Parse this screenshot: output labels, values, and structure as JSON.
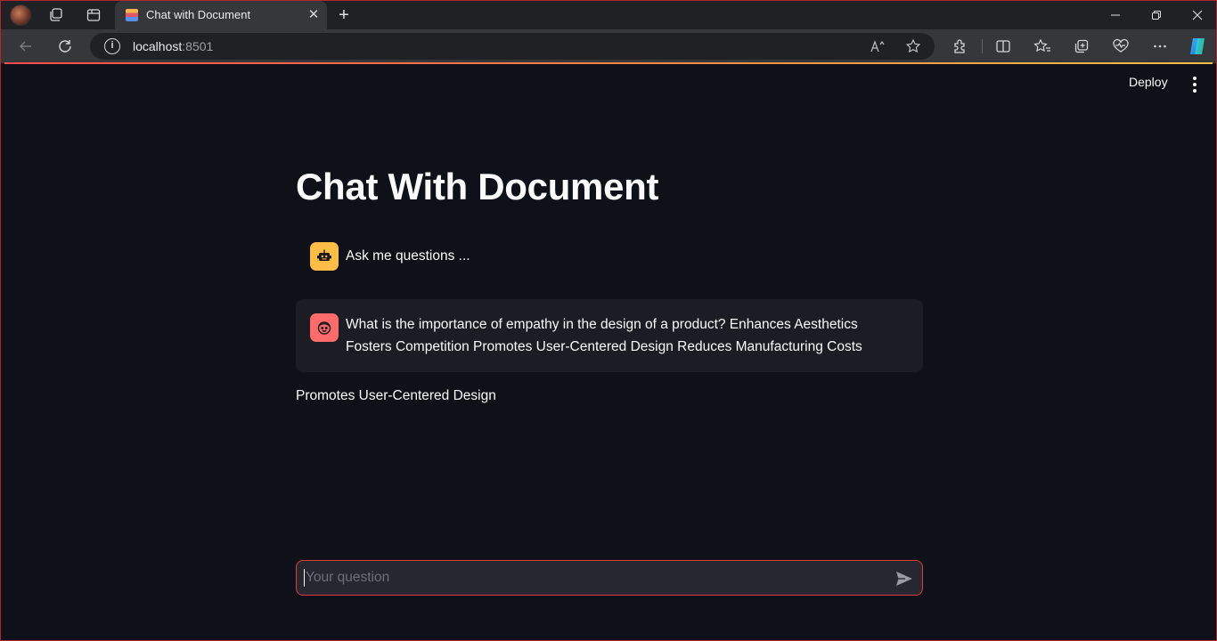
{
  "browser": {
    "tab_title": "Chat with Document",
    "url_host": "localhost",
    "url_port": ":8501"
  },
  "app": {
    "deploy_label": "Deploy",
    "title": "Chat With Document",
    "messages": [
      {
        "role": "assistant",
        "avatar_icon": "robot-icon",
        "text": "Ask me questions ..."
      },
      {
        "role": "user",
        "avatar_icon": "smiley-face-icon",
        "text": "What is the importance of empathy in the design of a product? Enhances Aesthetics Fosters Competition Promotes User-Centered Design Reduces Manufacturing Costs"
      }
    ],
    "answer": "Promotes User-Centered Design",
    "chat_input": {
      "placeholder": "Your question",
      "value": ""
    }
  },
  "colors": {
    "background": "#0e1117",
    "bot_avatar": "#ffbd45",
    "user_avatar": "#ff6b6b",
    "chat_input_border": "#e03c3c"
  }
}
